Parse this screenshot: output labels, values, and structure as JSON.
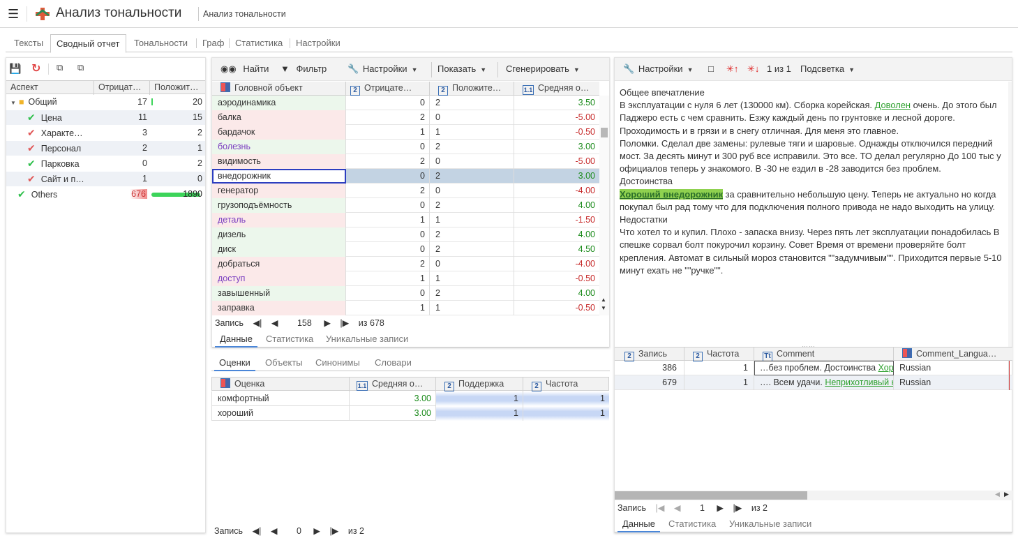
{
  "app": {
    "title": "Анализ тональности",
    "subtitle": "Анализ тональности"
  },
  "tabs": [
    "Тексты",
    "Сводный отчет",
    "Тональности",
    "Граф",
    "Статистика",
    "Настройки"
  ],
  "aspects": {
    "headers": [
      "Аспект",
      "Отрицат…",
      "Положит…"
    ],
    "rows": [
      {
        "name": "Общий",
        "neg": "17",
        "pos": "20",
        "icon": "folder-icon"
      },
      {
        "name": "Цена",
        "neg": "11",
        "pos": "15",
        "icon": "check-icon"
      },
      {
        "name": "Характе…",
        "neg": "3",
        "pos": "2",
        "icon": "cross-check-icon"
      },
      {
        "name": "Персонал",
        "neg": "2",
        "pos": "1",
        "icon": "cross-check-icon"
      },
      {
        "name": "Парковка",
        "neg": "0",
        "pos": "2",
        "icon": "check-icon"
      },
      {
        "name": "Сайт и п…",
        "neg": "1",
        "pos": "0",
        "icon": "cross-check-icon"
      },
      {
        "name": "Others",
        "neg": "676",
        "pos": "1890",
        "icon": "check-icon"
      }
    ]
  },
  "mid_toolbar": {
    "find": "Найти",
    "filter": "Фильтр",
    "settings": "Настройки",
    "show": "Показать",
    "generate": "Сгенерировать"
  },
  "objects": {
    "headers": [
      "Головной объект",
      "Отрицате…",
      "Положите…",
      "Средняя о…"
    ],
    "rows": [
      {
        "name": "аэродинамика",
        "neg": "0",
        "pos": "2",
        "avg": "3.50",
        "tone": "pos"
      },
      {
        "name": "балка",
        "neg": "2",
        "pos": "0",
        "avg": "-5.00",
        "tone": "neg"
      },
      {
        "name": "бардачок",
        "neg": "1",
        "pos": "1",
        "avg": "-0.50",
        "tone": "neg"
      },
      {
        "name": "болезнь",
        "neg": "0",
        "pos": "2",
        "avg": "3.00",
        "tone": "pos",
        "purple": true
      },
      {
        "name": "видимость",
        "neg": "2",
        "pos": "0",
        "avg": "-5.00",
        "tone": "neg"
      },
      {
        "name": "внедорожник",
        "neg": "0",
        "pos": "2",
        "avg": "3.00",
        "tone": "pos",
        "selected": true
      },
      {
        "name": "генератор",
        "neg": "2",
        "pos": "0",
        "avg": "-4.00",
        "tone": "neg"
      },
      {
        "name": "грузоподъёмность",
        "neg": "0",
        "pos": "2",
        "avg": "4.00",
        "tone": "pos"
      },
      {
        "name": "деталь",
        "neg": "1",
        "pos": "1",
        "avg": "-1.50",
        "tone": "neg",
        "purple": true
      },
      {
        "name": "дизель",
        "neg": "0",
        "pos": "2",
        "avg": "4.00",
        "tone": "pos"
      },
      {
        "name": "диск",
        "neg": "0",
        "pos": "2",
        "avg": "4.50",
        "tone": "pos"
      },
      {
        "name": "добраться",
        "neg": "2",
        "pos": "0",
        "avg": "-4.00",
        "tone": "neg"
      },
      {
        "name": "доступ",
        "neg": "1",
        "pos": "1",
        "avg": "-0.50",
        "tone": "neg",
        "purple": true
      },
      {
        "name": "завышенный",
        "neg": "0",
        "pos": "2",
        "avg": "4.00",
        "tone": "pos"
      },
      {
        "name": "заправка",
        "neg": "1",
        "pos": "1",
        "avg": "-0.50",
        "tone": "neg"
      }
    ],
    "pager": {
      "label": "Запись",
      "current": "158",
      "total": "из 678"
    },
    "subtabs": [
      "Данные",
      "Статистика",
      "Уникальные записи"
    ]
  },
  "ratings": {
    "tabs": [
      "Оценки",
      "Объекты",
      "Синонимы",
      "Словари"
    ],
    "headers": [
      "Оценка",
      "Средняя о…",
      "Поддержка",
      "Частота"
    ],
    "rows": [
      {
        "name": "комфортный",
        "avg": "3.00",
        "support": "1",
        "freq": "1"
      },
      {
        "name": "хороший",
        "avg": "3.00",
        "support": "1",
        "freq": "1"
      }
    ],
    "pager": {
      "label": "Запись",
      "current": "0",
      "total": "из 2"
    }
  },
  "right_toolbar": {
    "settings": "Настройки",
    "counter": "1 из 1",
    "highlight": "Подсветка"
  },
  "review": {
    "p1": "Общее впечатление",
    "p2a": "В эксплуатации с нуля 6 лет (130000 км). Сборка корейская. ",
    "p2link": "Доволен",
    "p2b": " очень. До этого был Паджеро есть с чем сравнить. Езжу каждый день по грунтовке и лесной дороге. Проходимость и в грязи и в снегу отличная. Для меня это главное.",
    "p3": "Поломки. Сделал две замены: рулевые тяги и шаровые. Однажды отключился передний мост. За десять минут и 300 руб все исправили. Это все. ТО делал регулярно До 100 тыс у официалов теперь у знакомого. В -30 не ездил в -28 заводится без проблем.",
    "p4": "Достоинства",
    "p5hl": "Хороший внедорожник",
    "p5b": " за сравнительно небольшую цену. Теперь не актуально но когда покупал был рад тому что для подключения полного привода не надо выходить на улицу.",
    "p6": "Недостатки",
    "p7": "Что хотел то и купил. Плохо - запаска внизу. Через пять лет эксплуатации понадобилась В спешке сорвал болт покурочил корзину. Совет Время от времени проверяйте болт крепления. Автомат в сильный мороз становится \"\"задумчивым\"\". Приходится первые 5-10 минут ехать не \"\"ручке\"\"."
  },
  "records": {
    "headers": [
      "Запись",
      "Частота",
      "Comment",
      "Comment_Langua…"
    ],
    "rows": [
      {
        "rec": "386",
        "freq": "1",
        "comment": "…без проблем. Достоинства ",
        "link": "Хор",
        "lang": "Russian"
      },
      {
        "rec": "679",
        "freq": "1",
        "comment": "…. Всем удачи. ",
        "link": "Неприхотливый к",
        "lang": "Russian"
      }
    ],
    "pager": {
      "label": "Запись",
      "current": "1",
      "total": "из 2"
    },
    "subtabs": [
      "Данные",
      "Статистика",
      "Уникальные записи"
    ]
  },
  "colors": {
    "accent": "#4a86d8",
    "positive": "#2dbf4a",
    "negative": "#e05555"
  }
}
